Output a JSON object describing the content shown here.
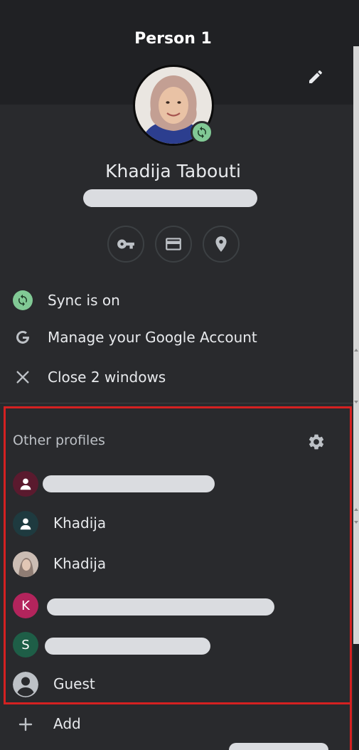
{
  "header": {
    "title": "Person 1"
  },
  "profile": {
    "name": "Khadija Tabouti"
  },
  "quick_actions": [
    {
      "icon": "key-icon"
    },
    {
      "icon": "credit-card-icon"
    },
    {
      "icon": "location-pin-icon"
    }
  ],
  "menu": {
    "sync": "Sync is on",
    "manage_account": "Manage your Google Account",
    "close_windows": "Close 2 windows"
  },
  "other_profiles": {
    "title": "Other profiles",
    "items": [
      {
        "label": "",
        "avatar_bg": "#5a1a2e"
      },
      {
        "label": "Khadija",
        "avatar_bg": "#1e3a3f"
      },
      {
        "label": "Khadija",
        "avatar_bg": "#c9b9b0"
      },
      {
        "label": "",
        "initial": "K",
        "avatar_bg": "#b3245c"
      },
      {
        "label": "",
        "initial": "S",
        "avatar_bg": "#1e5e47"
      },
      {
        "label": "Guest",
        "avatar_bg": "#bdc1c6"
      }
    ]
  },
  "footer": {
    "add": "Add"
  },
  "colors": {
    "panel_bg": "#292a2d",
    "header_bg": "#202124",
    "sync_green": "#81c995",
    "highlight_red": "#d42121"
  }
}
